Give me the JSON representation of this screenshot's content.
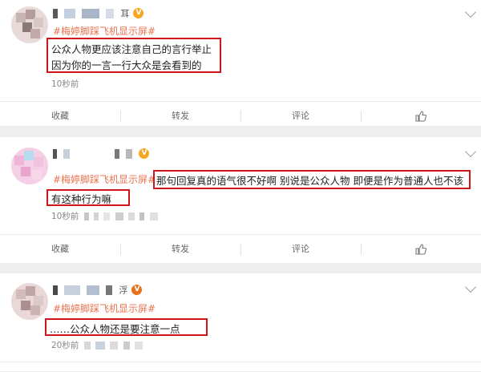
{
  "posts": [
    {
      "hashtag": "#梅婷脚踩飞机显示屏#",
      "lines": [
        "公众人物更应该注意自己的言行举止",
        "因为你的一言一行大众是会看到的"
      ],
      "time": "10秒前",
      "username_suffix": "耳",
      "badge": "V",
      "badge_color": "#f6a623"
    },
    {
      "hashtag": "#梅婷脚踩飞机显示屏#",
      "lines": [
        "那句回复真的语气很不好啊 别说是公众人物 即便是作为普通人也不该",
        "有这种行为嘛"
      ],
      "time": "10秒前",
      "username_suffix": "",
      "badge": "V",
      "badge_color": "#f6a623"
    },
    {
      "hashtag": "#梅婷脚踩飞机显示屏#",
      "lines": [
        "……公众人物还是要注意一点"
      ],
      "time": "20秒前",
      "username_suffix": "浮",
      "badge": "V",
      "badge_color": "#e8731c"
    }
  ],
  "actions": [
    "收藏",
    "转发",
    "评论"
  ],
  "icons": {
    "like": "thumbs-up-icon",
    "menu": "chevron-down-icon"
  },
  "colors": {
    "hashtag": "#eb7350",
    "highlight_box": "#d0151a"
  }
}
